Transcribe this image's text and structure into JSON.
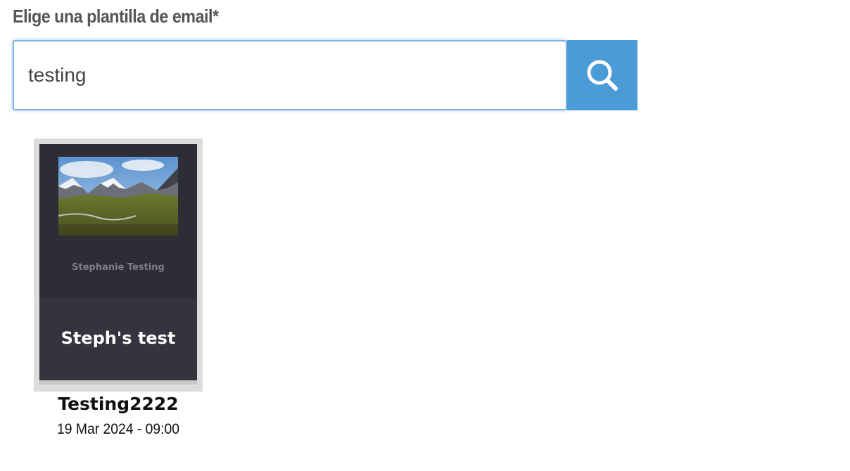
{
  "form": {
    "label": "Elige una plantilla de email*",
    "search_value": "testing",
    "search_button_icon": "search-icon"
  },
  "colors": {
    "search_button_bg": "#4b9bd7",
    "input_border": "#7fb0e0",
    "card_dark": "#2c2d35"
  },
  "templates": [
    {
      "preview_sender": "Stephanie Testing",
      "preview_heading": "Steph's test",
      "name": "Testing2222",
      "date": "19 Mar 2024 - 09:00"
    }
  ]
}
